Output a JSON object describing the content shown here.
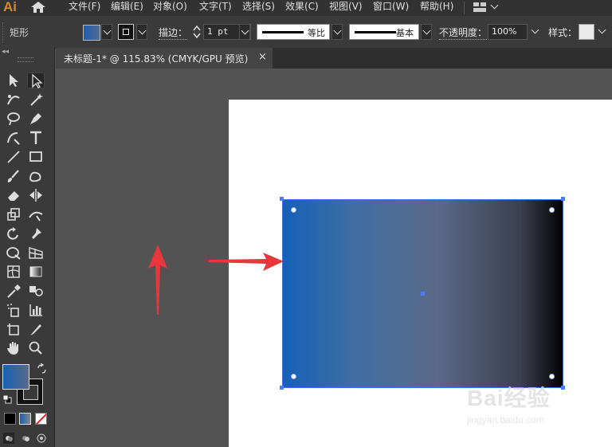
{
  "app": {
    "logo": "Ai",
    "home_icon": "home-icon"
  },
  "menu": [
    "文件(F)",
    "编辑(E)",
    "对象(O)",
    "文字(T)",
    "选择(S)",
    "效果(C)",
    "视图(V)",
    "窗口(W)",
    "帮助(H)"
  ],
  "control": {
    "object_type": "矩形",
    "stroke_label": "描边：",
    "stroke_weight": "1 pt",
    "profile_uniform": "等比",
    "brush_basic": "基本",
    "opacity_label": "不透明度：",
    "opacity_value": "100%",
    "style_label": "样式："
  },
  "document": {
    "tab_title": "未标题-1* @ 115.83% (CMYK/GPU 预览)",
    "close_glyph": "×"
  },
  "tools": [
    "selection-tool",
    "direct-selection-tool",
    "curvature-tool",
    "magic-wand-tool",
    "lasso-tool",
    "pen-tool",
    "anchor-tool",
    "type-tool",
    "line-tool",
    "rectangle-tool",
    "paintbrush-tool",
    "blob-brush-tool",
    "eraser-tool",
    "reflect-tool",
    "scale-tool",
    "reshape-tool",
    "rotate-tool",
    "pin-tool",
    "warp-tool",
    "perspective-tool",
    "mesh-tool",
    "gradient-tool",
    "eyedropper-tool",
    "blend-tool",
    "symbol-sprayer-tool",
    "graph-tool",
    "artboard-tool",
    "slice-tool",
    "hand-tool",
    "zoom-tool"
  ],
  "colors": {
    "fill_start": "#1560b8",
    "fill_end": "#030303",
    "arrow": "#e8363a",
    "selection": "#4a6ef0"
  },
  "watermark": {
    "brand": "Bai经验",
    "url": "jingyan.baidu.com"
  }
}
